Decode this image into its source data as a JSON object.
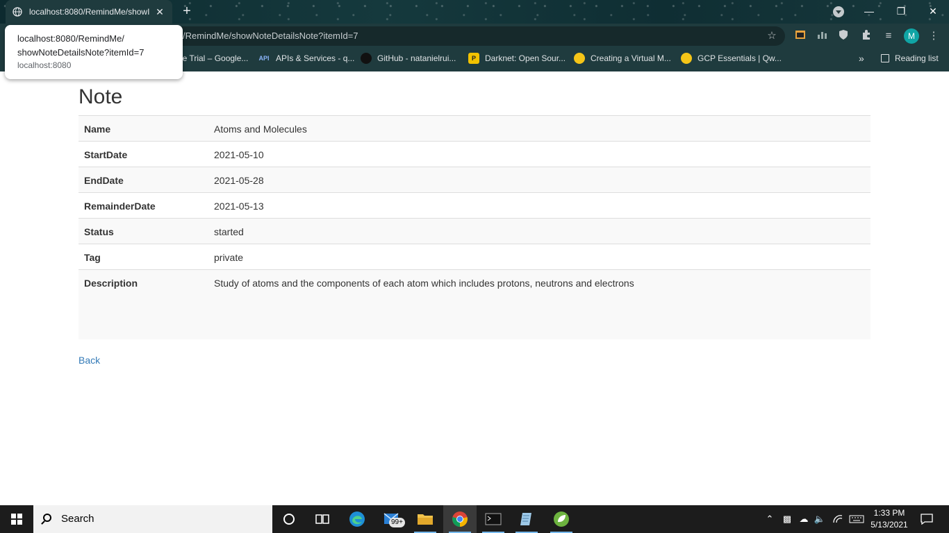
{
  "browser": {
    "tab_title": "localhost:8080/RemindMe/showI",
    "tab_close": "✕",
    "new_tab": "+",
    "address_visible": "/RemindMe/showNoteDetailsNote?itemId=7",
    "tooltip": {
      "url_line1": "localhost:8080/RemindMe/",
      "url_line2": "showNoteDetailsNote?itemId=7",
      "host": "localhost:8080"
    },
    "avatar_letter": "M",
    "bookmarks": [
      {
        "label": "ee Trial – Google...",
        "icon": "google-cloud-icon"
      },
      {
        "label": "APIs & Services - q...",
        "icon": "api-icon",
        "badge": "API"
      },
      {
        "label": "GitHub - natanielrui...",
        "icon": "github-icon"
      },
      {
        "label": "Darknet: Open Sour...",
        "icon": "darknet-icon"
      },
      {
        "label": "Creating a Virtual M...",
        "icon": "qwiklabs-icon"
      },
      {
        "label": "GCP Essentials | Qw...",
        "icon": "qwiklabs-icon"
      }
    ],
    "bookmarks_overflow": "»",
    "reading_list": "Reading list"
  },
  "page": {
    "title": "Note",
    "rows": [
      {
        "label": "Name",
        "value": "Atoms and Molecules"
      },
      {
        "label": "StartDate",
        "value": "2021-05-10"
      },
      {
        "label": "EndDate",
        "value": "2021-05-28"
      },
      {
        "label": "RemainderDate",
        "value": "2021-05-13"
      },
      {
        "label": "Status",
        "value": "started"
      },
      {
        "label": "Tag",
        "value": "private"
      },
      {
        "label": "Description",
        "value": "Study of atoms and the components of each atom which includes protons, neutrons and electrons"
      }
    ],
    "back_link": "Back"
  },
  "taskbar": {
    "search_placeholder": "Search",
    "mail_badge": "99+",
    "time": "1:33 PM",
    "date": "5/13/2021"
  },
  "colors": {
    "link": "#337ab7",
    "chrome_bg": "#1f3b3e",
    "avatar": "#10a5a5"
  }
}
